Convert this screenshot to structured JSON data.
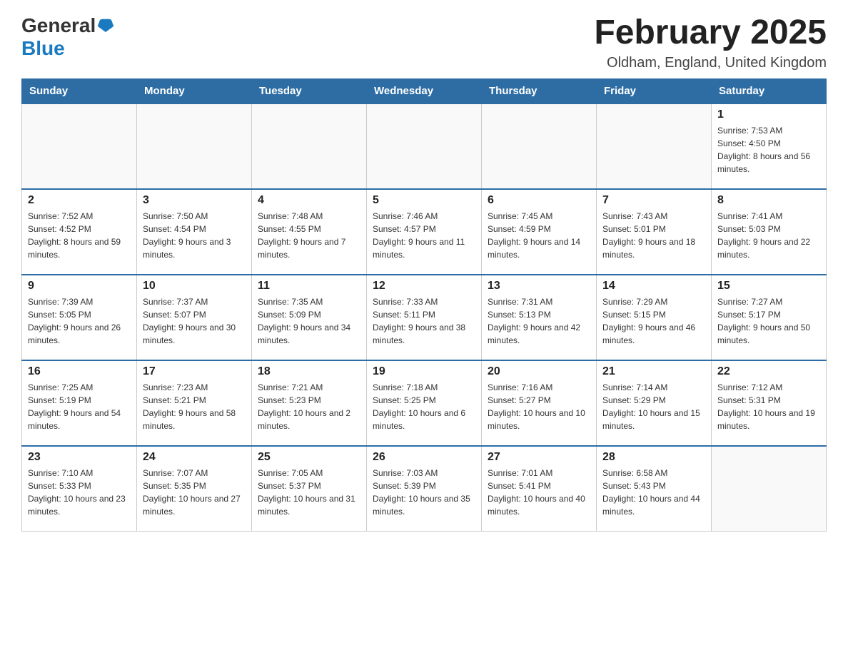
{
  "header": {
    "logo_general": "General",
    "logo_blue": "Blue",
    "title": "February 2025",
    "subtitle": "Oldham, England, United Kingdom"
  },
  "calendar": {
    "days_of_week": [
      "Sunday",
      "Monday",
      "Tuesday",
      "Wednesday",
      "Thursday",
      "Friday",
      "Saturday"
    ],
    "weeks": [
      [
        {
          "day": "",
          "info": ""
        },
        {
          "day": "",
          "info": ""
        },
        {
          "day": "",
          "info": ""
        },
        {
          "day": "",
          "info": ""
        },
        {
          "day": "",
          "info": ""
        },
        {
          "day": "",
          "info": ""
        },
        {
          "day": "1",
          "info": "Sunrise: 7:53 AM\nSunset: 4:50 PM\nDaylight: 8 hours and 56 minutes."
        }
      ],
      [
        {
          "day": "2",
          "info": "Sunrise: 7:52 AM\nSunset: 4:52 PM\nDaylight: 8 hours and 59 minutes."
        },
        {
          "day": "3",
          "info": "Sunrise: 7:50 AM\nSunset: 4:54 PM\nDaylight: 9 hours and 3 minutes."
        },
        {
          "day": "4",
          "info": "Sunrise: 7:48 AM\nSunset: 4:55 PM\nDaylight: 9 hours and 7 minutes."
        },
        {
          "day": "5",
          "info": "Sunrise: 7:46 AM\nSunset: 4:57 PM\nDaylight: 9 hours and 11 minutes."
        },
        {
          "day": "6",
          "info": "Sunrise: 7:45 AM\nSunset: 4:59 PM\nDaylight: 9 hours and 14 minutes."
        },
        {
          "day": "7",
          "info": "Sunrise: 7:43 AM\nSunset: 5:01 PM\nDaylight: 9 hours and 18 minutes."
        },
        {
          "day": "8",
          "info": "Sunrise: 7:41 AM\nSunset: 5:03 PM\nDaylight: 9 hours and 22 minutes."
        }
      ],
      [
        {
          "day": "9",
          "info": "Sunrise: 7:39 AM\nSunset: 5:05 PM\nDaylight: 9 hours and 26 minutes."
        },
        {
          "day": "10",
          "info": "Sunrise: 7:37 AM\nSunset: 5:07 PM\nDaylight: 9 hours and 30 minutes."
        },
        {
          "day": "11",
          "info": "Sunrise: 7:35 AM\nSunset: 5:09 PM\nDaylight: 9 hours and 34 minutes."
        },
        {
          "day": "12",
          "info": "Sunrise: 7:33 AM\nSunset: 5:11 PM\nDaylight: 9 hours and 38 minutes."
        },
        {
          "day": "13",
          "info": "Sunrise: 7:31 AM\nSunset: 5:13 PM\nDaylight: 9 hours and 42 minutes."
        },
        {
          "day": "14",
          "info": "Sunrise: 7:29 AM\nSunset: 5:15 PM\nDaylight: 9 hours and 46 minutes."
        },
        {
          "day": "15",
          "info": "Sunrise: 7:27 AM\nSunset: 5:17 PM\nDaylight: 9 hours and 50 minutes."
        }
      ],
      [
        {
          "day": "16",
          "info": "Sunrise: 7:25 AM\nSunset: 5:19 PM\nDaylight: 9 hours and 54 minutes."
        },
        {
          "day": "17",
          "info": "Sunrise: 7:23 AM\nSunset: 5:21 PM\nDaylight: 9 hours and 58 minutes."
        },
        {
          "day": "18",
          "info": "Sunrise: 7:21 AM\nSunset: 5:23 PM\nDaylight: 10 hours and 2 minutes."
        },
        {
          "day": "19",
          "info": "Sunrise: 7:18 AM\nSunset: 5:25 PM\nDaylight: 10 hours and 6 minutes."
        },
        {
          "day": "20",
          "info": "Sunrise: 7:16 AM\nSunset: 5:27 PM\nDaylight: 10 hours and 10 minutes."
        },
        {
          "day": "21",
          "info": "Sunrise: 7:14 AM\nSunset: 5:29 PM\nDaylight: 10 hours and 15 minutes."
        },
        {
          "day": "22",
          "info": "Sunrise: 7:12 AM\nSunset: 5:31 PM\nDaylight: 10 hours and 19 minutes."
        }
      ],
      [
        {
          "day": "23",
          "info": "Sunrise: 7:10 AM\nSunset: 5:33 PM\nDaylight: 10 hours and 23 minutes."
        },
        {
          "day": "24",
          "info": "Sunrise: 7:07 AM\nSunset: 5:35 PM\nDaylight: 10 hours and 27 minutes."
        },
        {
          "day": "25",
          "info": "Sunrise: 7:05 AM\nSunset: 5:37 PM\nDaylight: 10 hours and 31 minutes."
        },
        {
          "day": "26",
          "info": "Sunrise: 7:03 AM\nSunset: 5:39 PM\nDaylight: 10 hours and 35 minutes."
        },
        {
          "day": "27",
          "info": "Sunrise: 7:01 AM\nSunset: 5:41 PM\nDaylight: 10 hours and 40 minutes."
        },
        {
          "day": "28",
          "info": "Sunrise: 6:58 AM\nSunset: 5:43 PM\nDaylight: 10 hours and 44 minutes."
        },
        {
          "day": "",
          "info": ""
        }
      ]
    ]
  }
}
